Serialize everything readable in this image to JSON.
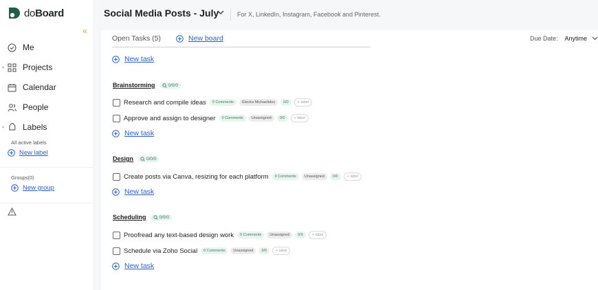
{
  "sidebar": {
    "logo": {
      "prefix": "do",
      "bold": "Board"
    },
    "nav": [
      {
        "label": "Me",
        "icon": "check-circle-icon"
      },
      {
        "label": "Projects",
        "icon": "grid-icon"
      },
      {
        "label": "Calendar",
        "icon": "calendar-icon"
      },
      {
        "label": "People",
        "icon": "people-icon"
      },
      {
        "label": "Labels",
        "icon": "tag-icon"
      }
    ],
    "labels_caption": "All active labels",
    "new_label": "New label",
    "groups_caption": "Groups(0)",
    "new_group": "New group"
  },
  "header": {
    "title": "Social Media Posts - July",
    "subtitle": "For X, LinkedIn, Instagram, Facebook and Pinterest."
  },
  "toolbar": {
    "open_tasks": "Open Tasks (5)",
    "new_board": "New board",
    "due_label": "Due Date:",
    "due_value": "Anytime"
  },
  "new_task_label": "New task",
  "groups": [
    {
      "title": "Brainstorming",
      "count": "0/0/0",
      "tasks": [
        {
          "name": "Research and compile ideas",
          "comments": "0 Comments",
          "assignee": "Electra Michaelidou",
          "ratio": "0/0",
          "label": "+ label"
        },
        {
          "name": "Approve and assign to designer",
          "comments": "0 Comments",
          "assignee": "Unassigned",
          "ratio": "0/0",
          "label": "+ label"
        }
      ]
    },
    {
      "title": "Design",
      "count": "0/0/0",
      "tasks": [
        {
          "name": "Create posts via Canva, resizing for each platform",
          "comments": "0 Comments",
          "assignee": "Unassigned",
          "ratio": "0/0",
          "label": "+ label"
        }
      ]
    },
    {
      "title": "Scheduling",
      "count": "0/0/0",
      "tasks": [
        {
          "name": "Proofread any text-based design work",
          "comments": "0 Comments",
          "assignee": "Unassigned",
          "ratio": "0/0",
          "label": "+ label"
        },
        {
          "name": "Schedule via Zoho Social",
          "comments": "0 Comments",
          "assignee": "Unassigned",
          "ratio": "0/0",
          "label": "+ label"
        }
      ]
    }
  ],
  "colors": {
    "brand": "#1f5f3f",
    "link": "#2c5fc7",
    "accent": "#d5a21a"
  }
}
